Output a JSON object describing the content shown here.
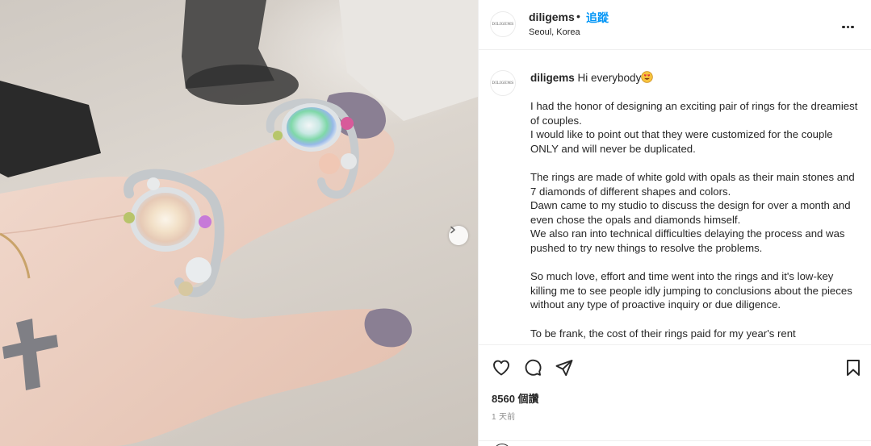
{
  "post": {
    "username": "diligems",
    "separator": "•",
    "follow_label": "追蹤",
    "location": "Seoul, Korea",
    "avatar_text": "DILIGEMS",
    "more_icon": "more-horizontal-icon"
  },
  "caption": {
    "username": "diligems",
    "greeting": "Hi everybody",
    "emoji": "smiling-face-with-heart-eyes",
    "paragraphs": [
      "I had the honor of designing an exciting pair of rings for the dreamiest of couples.\nI would like to point out that they were customized for the couple ONLY and will never be duplicated.",
      "The rings are made of white gold with opals as their main stones and 7 diamonds of different shapes and colors.\nDawn came to my studio to discuss the design for over a month and even chose the opals and diamonds himself.\nWe also ran into technical difficulties delaying the process and was pushed to try new things to resolve the problems.",
      "So much love, effort and time went into the rings and it's low-key killing me to see people idly jumping to conclusions about the pieces without any type of proactive inquiry or due diligence.",
      "To be frank, the cost of their rings paid for my year's rent"
    ]
  },
  "actions": {
    "like_icon": "heart-icon",
    "comment_icon": "comment-icon",
    "share_icon": "send-icon",
    "save_icon": "bookmark-icon",
    "likes_text": "8560 個讚",
    "time_text": "1 天前"
  },
  "media": {
    "next_icon": "chevron-right-icon",
    "colors": {
      "accent": "#0095f6",
      "text": "#262626",
      "muted": "#8e8e8e"
    }
  }
}
